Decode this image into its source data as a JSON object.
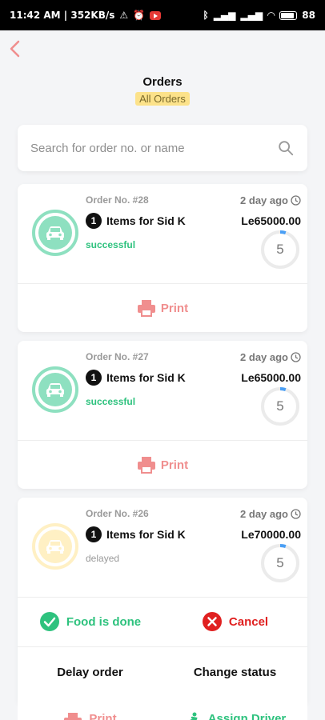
{
  "statusbar": {
    "time_net": "11:42 AM | 352KB/s",
    "battery": "88"
  },
  "header": {
    "title": "Orders",
    "filter": "All Orders"
  },
  "search": {
    "placeholder": "Search for order no. or name"
  },
  "orders": [
    {
      "order_no": "Order No. #28",
      "qty": "1",
      "items": "Items for Sid K",
      "status": "successful",
      "ago": "2 day ago",
      "price": "Le65000.00",
      "timer": "5",
      "timer_progress": 0.05,
      "print": "Print"
    },
    {
      "order_no": "Order No. #27",
      "qty": "1",
      "items": "Items for Sid K",
      "status": "successful",
      "ago": "2 day ago",
      "price": "Le65000.00",
      "timer": "5",
      "timer_progress": 0.05,
      "print": "Print"
    },
    {
      "order_no": "Order No. #26",
      "qty": "1",
      "items": "Items for Sid K",
      "status": "delayed",
      "ago": "2 day ago",
      "price": "Le70000.00",
      "timer": "5",
      "timer_progress": 0.05,
      "print": "Print"
    }
  ],
  "actions": {
    "food_done": "Food is done",
    "cancel": "Cancel",
    "delay": "Delay order",
    "change_status": "Change status",
    "print": "Print",
    "assign_driver": "Assign Driver"
  },
  "colors": {
    "success": "#2ec27e",
    "danger": "#e02020",
    "print": "#f08e8e",
    "chip": "#fce28a"
  }
}
